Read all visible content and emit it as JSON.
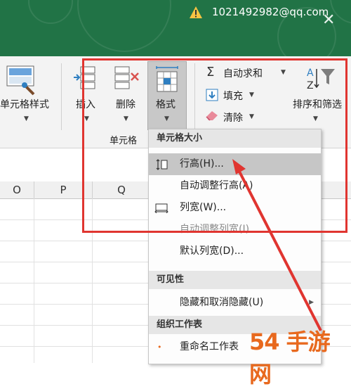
{
  "titlebar": {
    "account": "1021492982@qq.com",
    "close": "✕"
  },
  "ribbon": {
    "cell_styles": "单元格样式",
    "insert": "插入",
    "delete": "删除",
    "format": "格式",
    "group_cells": "单元格",
    "autosum": "自动求和",
    "fill": "填充",
    "clear": "清除",
    "sort_filter": "排序和筛选"
  },
  "columns": [
    "O",
    "P",
    "Q"
  ],
  "menu": {
    "section_cell_size": "单元格大小",
    "row_height": "行高(H)...",
    "autofit_row": "自动调整行高(A)",
    "column_width": "列宽(W)...",
    "autofit_column": "自动调整列宽(I)",
    "default_width": "默认列宽(D)...",
    "section_visibility": "可见性",
    "hide_unhide": "隐藏和取消隐藏(U)",
    "section_organize": "组织工作表",
    "rename_sheet": "重命名工作表"
  },
  "watermark": "54 手游网",
  "colors": {
    "title_green": "#217346",
    "highlight_red": "#e03530"
  }
}
